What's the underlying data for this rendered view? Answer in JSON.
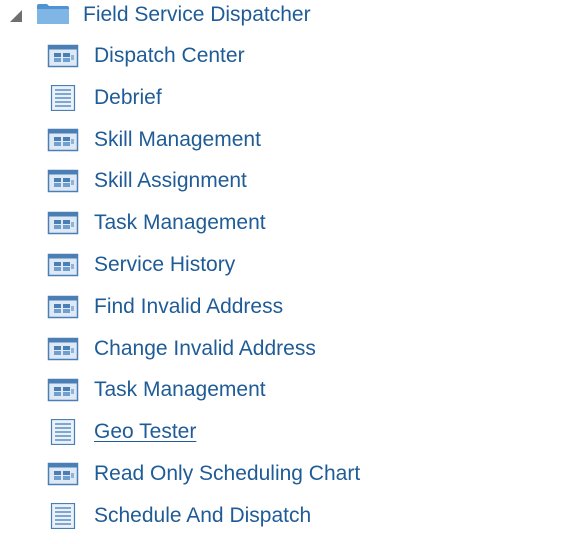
{
  "tree": {
    "root": {
      "label": "Field Service Dispatcher",
      "expanded": true,
      "icon": "folder-icon"
    },
    "items": [
      {
        "label": "Dispatch Center",
        "icon": "window-icon"
      },
      {
        "label": "Debrief",
        "icon": "document-icon"
      },
      {
        "label": "Skill Management",
        "icon": "window-icon"
      },
      {
        "label": "Skill Assignment",
        "icon": "window-icon"
      },
      {
        "label": "Task Management",
        "icon": "window-icon"
      },
      {
        "label": "Service History",
        "icon": "window-icon"
      },
      {
        "label": "Find Invalid Address",
        "icon": "window-icon"
      },
      {
        "label": "Change Invalid Address",
        "icon": "window-icon"
      },
      {
        "label": "Task Management",
        "icon": "window-icon"
      },
      {
        "label": "Geo Tester",
        "icon": "document-icon",
        "hovered": true
      },
      {
        "label": "Read Only Scheduling Chart",
        "icon": "window-icon"
      },
      {
        "label": "Schedule And Dispatch",
        "icon": "document-icon"
      }
    ]
  },
  "colors": {
    "link_text": "#1f5c97",
    "folder_fill": "#5aa0d8",
    "icon_border": "#4a7fb5",
    "icon_fill": "#dfe9f5"
  }
}
